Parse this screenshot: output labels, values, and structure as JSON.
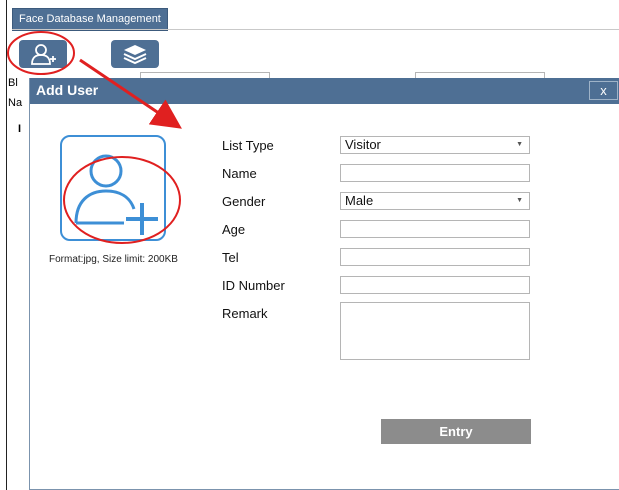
{
  "tab": {
    "label": "Face Database Management"
  },
  "behind": {
    "label_1": "Bl",
    "label_2": "Na",
    "label_3": "I"
  },
  "modal": {
    "title": "Add User",
    "close_label": "x",
    "format_note": "Format:jpg, Size limit: 200KB",
    "fields": {
      "list_type": {
        "label": "List Type",
        "value": "Visitor"
      },
      "name": {
        "label": "Name",
        "value": ""
      },
      "gender": {
        "label": "Gender",
        "value": "Male"
      },
      "age": {
        "label": "Age",
        "value": ""
      },
      "tel": {
        "label": "Tel",
        "value": ""
      },
      "id_number": {
        "label": "ID Number",
        "value": ""
      },
      "remark": {
        "label": "Remark",
        "value": ""
      }
    },
    "entry_label": "Entry"
  },
  "colors": {
    "header_blue": "#4e6f94",
    "avatar_blue": "#3d8fd6",
    "annotation_red": "#e02020",
    "entry_gray": "#8c8c8c"
  },
  "icons": [
    "add-user-icon",
    "layers-icon",
    "avatar-add-user-icon",
    "close-icon",
    "dropdown-caret-icon"
  ]
}
